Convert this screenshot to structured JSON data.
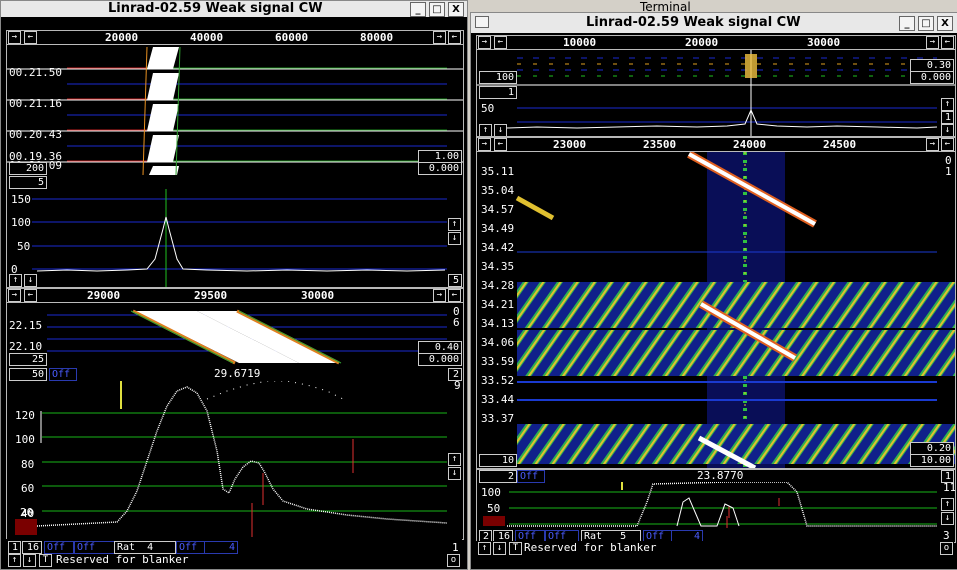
{
  "left_window": {
    "title": "Linrad-02.59 Weak signal CW",
    "controls": {
      "minimize": "_",
      "maximize": "□",
      "close": "X"
    },
    "wide_scale_ticks": [
      "20000",
      "40000",
      "60000",
      "80000"
    ],
    "waterfall_times": [
      "00.21.50",
      "00.21.16",
      "00.20.43",
      "00.20.09",
      "00.19.36"
    ],
    "waterfall_boxes": {
      "gain": "1.00",
      "zero": "0.000",
      "avg": "200",
      "avg2": "5"
    },
    "spectrum_ylabels": [
      "150",
      "100",
      "50",
      "0"
    ],
    "spectrum_box": "5",
    "baseband_scale_ticks": [
      "29000",
      "29500",
      "30000"
    ],
    "baseband_wf_times": [
      "22.15",
      "22.10"
    ],
    "baseband_wf_right": [
      "0",
      "6"
    ],
    "baseband_boxes": {
      "avg": "25",
      "gain": "0.40",
      "zero": "0.000"
    },
    "baseband_row": {
      "left": "50",
      "mode": "Off",
      "freq": "29.6719",
      "right": "2",
      "right2": "9"
    },
    "baseband_ylabels": [
      "120",
      "100",
      "80",
      "60",
      "40",
      "20"
    ],
    "bottom_controls": {
      "ch": "1",
      "bits": "16",
      "off1": "Off",
      "off2": "Off",
      "rat_label": "Rat",
      "rat": "4",
      "off3": "Off",
      "num": "4",
      "right": "1"
    },
    "blanker_text": "Reserved for blanker",
    "blanker_btn": "T",
    "blanker_right": "o"
  },
  "terminal_label": "Terminal",
  "right_window": {
    "title": "Linrad-02.59 Weak signal CW",
    "controls": {
      "minimize": "_",
      "maximize": "□",
      "close": "X"
    },
    "wide_scale_ticks": [
      "10000",
      "20000",
      "30000"
    ],
    "wide_boxes": {
      "avg": "100",
      "avg2": "1",
      "gain": "0.30",
      "zero": "0.000"
    },
    "spectrum_ylabels": [
      "50"
    ],
    "spectrum_right": "1",
    "hires_scale_ticks": [
      "23000",
      "23500",
      "24000",
      "24500"
    ],
    "hires_right": [
      "0",
      "1"
    ],
    "hires_times": [
      "35.11",
      "35.04",
      "34.57",
      "34.49",
      "34.42",
      "34.35",
      "34.28",
      "34.21",
      "34.13",
      "34.06",
      "33.59",
      "33.52",
      "33.44",
      "33.37"
    ],
    "hires_boxes": {
      "avg": "10",
      "gain": "0.20",
      "zero": "10.00"
    },
    "baseband_row": {
      "left": "2",
      "mode": "Off",
      "freq": "23.8770",
      "right": "1",
      "right2": "11"
    },
    "baseband_ylabels": [
      "100",
      "50"
    ],
    "bottom_controls": {
      "ch": "2",
      "bits": "16",
      "off1": "Off",
      "off2": "Off",
      "rat_label": "Rat",
      "rat": "5",
      "off3": "Off",
      "num": "4",
      "right": "3"
    },
    "blanker_text": "Reserved for blanker",
    "blanker_btn": "T",
    "blanker_right": "o"
  },
  "colors": {
    "grid": "#1a2ad0",
    "green_grid": "#19b419",
    "bg": "#000000",
    "frame": "#d4d0c8"
  }
}
